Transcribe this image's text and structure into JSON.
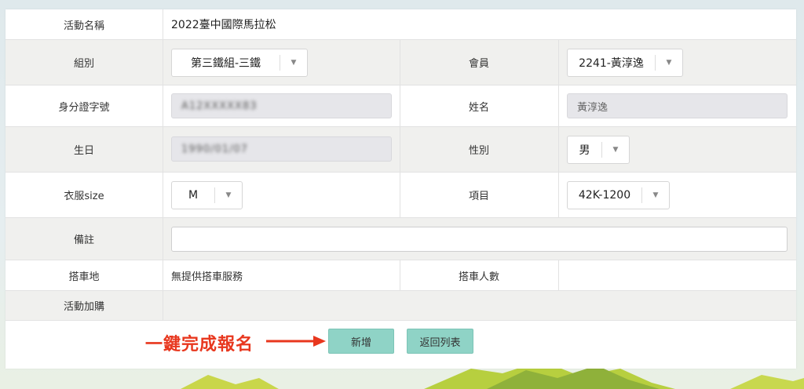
{
  "form": {
    "event": {
      "label": "活動名稱",
      "value": "2022臺中國際馬拉松"
    },
    "group": {
      "label": "組別",
      "selected": "第三鐵組-三鐵"
    },
    "member": {
      "label": "會員",
      "selected": "2241-黃淳逸"
    },
    "id_number": {
      "label": "身分證字號",
      "value": "A12XXXXX83"
    },
    "name": {
      "label": "姓名",
      "value": "黃淳逸"
    },
    "birthday": {
      "label": "生日",
      "value": "1990/01/07"
    },
    "gender": {
      "label": "性別",
      "selected": "男"
    },
    "clothing": {
      "label": "衣服size",
      "selected": "M"
    },
    "item": {
      "label": "項目",
      "selected": "42K-1200"
    },
    "note": {
      "label": "備註",
      "value": ""
    },
    "pickup": {
      "label": "搭車地",
      "value": "無提供搭車服務"
    },
    "pickup_count": {
      "label": "搭車人數",
      "value": ""
    },
    "addon": {
      "label": "活動加購",
      "value": ""
    }
  },
  "actions": {
    "promo": "一鍵完成報名",
    "add_label": "新增",
    "back_label": "返回列表"
  },
  "colors": {
    "button": "#8fd3c6",
    "promo": "#e8371e"
  }
}
